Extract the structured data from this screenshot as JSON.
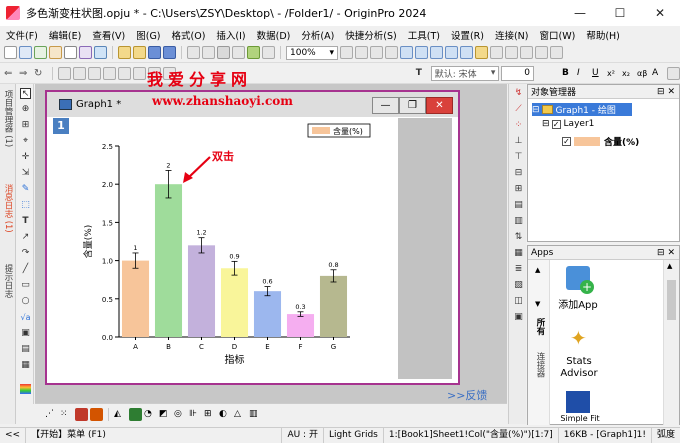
{
  "window": {
    "title": "多色渐变柱状图.opju * - C:\\Users\\ZSY\\Desktop\\ - /Folder1/ - OriginPro 2024",
    "minimize": "—",
    "maximize": "☐",
    "close": "✕"
  },
  "menu": [
    "文件(F)",
    "编辑(E)",
    "查看(V)",
    "图(G)",
    "格式(O)",
    "插入(I)",
    "数据(D)",
    "分析(A)",
    "快捷分析(S)",
    "工具(T)",
    "设置(R)",
    "连接(N)",
    "窗口(W)",
    "帮助(H)"
  ],
  "toolbar": {
    "zoom": "100%",
    "font": "默认: 宋体",
    "font_size": "0"
  },
  "left_tabs": [
    "项目管理器 (1)",
    "消息日志 (1)",
    "提示日志"
  ],
  "graph_window": {
    "title": "Graph1 *",
    "layer_badge": "1"
  },
  "watermark": {
    "cn": "我爱分享网",
    "url": "www.zhanshaoyi.com"
  },
  "annotation": "双击",
  "feedback_link": ">>反馈",
  "object_manager": {
    "header": "对象管理器",
    "graph_node": "Graph1 - 绘图",
    "layer_node": "Layer1",
    "plot_node": "含量(%)"
  },
  "apps": {
    "header": "Apps",
    "tabs": [
      "所有",
      "连接器"
    ],
    "items": [
      "添加App",
      "Stats Advisor",
      "Simple Fit"
    ]
  },
  "status_bar": {
    "nav": "<<",
    "start": "【开始】菜单 (F1)",
    "au": "AU : 开",
    "grids": "Light Grids",
    "cell": "1:[Book1]Sheet1!Col(\"含量(%)\")[1:7]",
    "mem": "16KB - [Graph1]1!",
    "unit": "弧度"
  },
  "colors": {
    "accent_window_border": "#a6338f",
    "annotation_red": "#e60012",
    "link_blue": "#3a6fc4"
  },
  "chart_data": {
    "type": "bar",
    "categories": [
      "A",
      "B",
      "C",
      "D",
      "E",
      "F",
      "G"
    ],
    "values": [
      1.0,
      2.0,
      1.2,
      0.9,
      0.6,
      0.3,
      0.8
    ],
    "errors": [
      0.1,
      0.18,
      0.1,
      0.09,
      0.06,
      0.03,
      0.08
    ],
    "value_labels": [
      "1",
      "2",
      "1.2",
      "0.9",
      "0.6",
      "0.3",
      "0.8"
    ],
    "colors": [
      "#f7c59a",
      "#9fdc9b",
      "#c3b1dc",
      "#f9f59a",
      "#9cb7ee",
      "#f5aef0",
      "#b6b88f"
    ],
    "xlabel": "指标",
    "ylabel": "含量(%)",
    "ylim": [
      0,
      2.5
    ],
    "yticks": [
      "0.0",
      "0.5",
      "1.0",
      "1.5",
      "2.0",
      "2.5"
    ],
    "legend": {
      "label": "含量(%)",
      "position": "top-right"
    }
  }
}
